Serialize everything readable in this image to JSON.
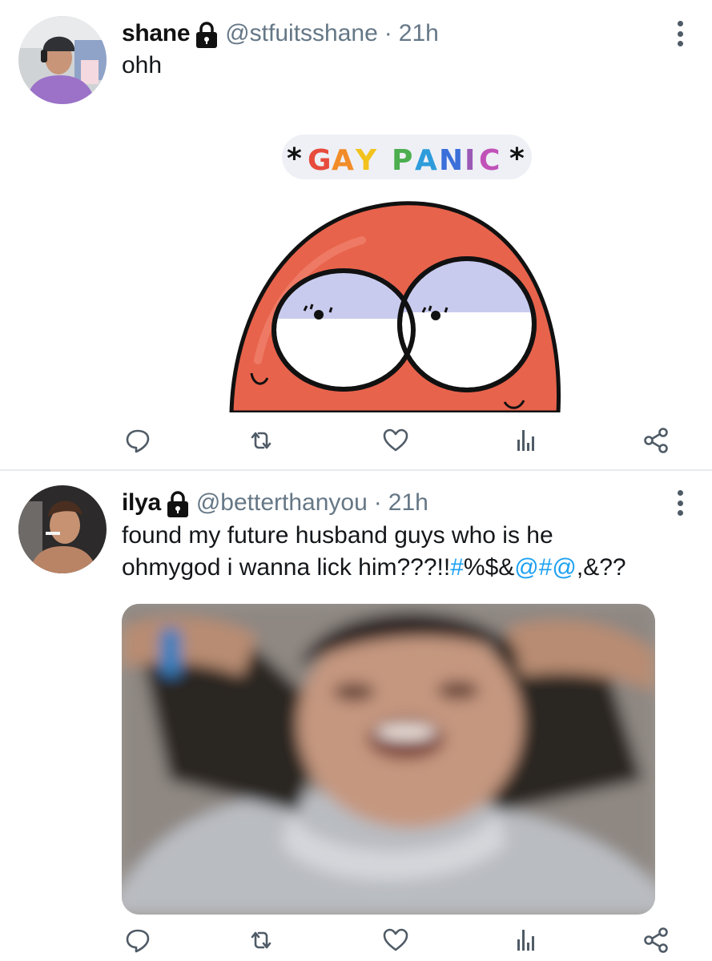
{
  "tweets": [
    {
      "name": "shane",
      "handle": "@stfuitsshane",
      "separator": "·",
      "time": "21h",
      "text": "ohh",
      "media_caption": "*GAY PANIC*"
    },
    {
      "name": "ilya",
      "handle": "@betterthanyou",
      "separator": "·",
      "time": "21h",
      "text_line1": "found my future husband guys who is he",
      "text_line2_plain": "ohmygod i wanna lick him???!!",
      "text_line2_link1": "#",
      "text_line2_mid": "%$&",
      "text_line2_link2": "@#@",
      "text_line2_end": ",&??"
    }
  ],
  "icons": {
    "lock": "lock-icon",
    "more": "more-vertical-icon",
    "reply": "reply-icon",
    "retweet": "retweet-icon",
    "like": "heart-icon",
    "stats": "bar-chart-icon",
    "share": "share-icon"
  },
  "colors": {
    "link": "#1da1f2",
    "secondary_text": "#657786",
    "icon": "#657786",
    "divider": "#e6ecf0"
  }
}
